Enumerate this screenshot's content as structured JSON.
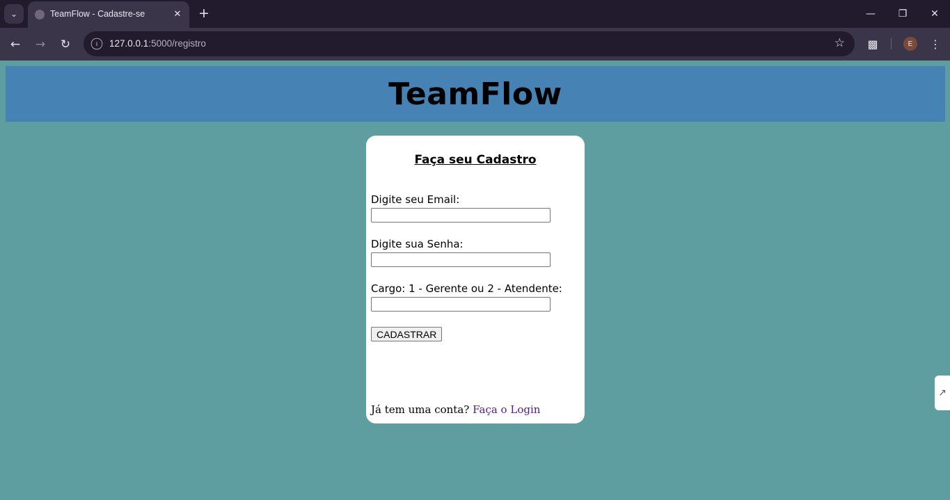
{
  "browser": {
    "tab_title": "TeamFlow - Cadastre-se",
    "url_host": "127.0.0.1",
    "url_rest": ":5000/registro",
    "profile_initial": "E"
  },
  "page": {
    "site_title": "TeamFlow",
    "form_title": "Faça seu Cadastro",
    "email_label": "Digite seu Email:",
    "email_value": "",
    "password_label": "Digite sua Senha:",
    "password_value": "",
    "role_label": "Cargo: 1 - Gerente ou 2 - Atendente:",
    "role_value": "",
    "submit_label": "CADASTRAR",
    "login_prompt": "Já tem uma conta?",
    "login_link": "Faça o Login"
  },
  "colors": {
    "page_bg": "#5f9ea0",
    "header_bg": "#4682b4",
    "card_bg": "#ffffff",
    "link": "#551a8b"
  },
  "icons": {
    "tab_list": "chevron-down-icon",
    "close": "close-icon",
    "new_tab": "plus-icon",
    "back": "back-arrow-icon",
    "forward": "forward-arrow-icon",
    "reload": "reload-icon",
    "site_info": "info-icon",
    "bookmark": "star-icon",
    "extensions": "puzzle-icon",
    "menu": "kebab-menu-icon"
  }
}
